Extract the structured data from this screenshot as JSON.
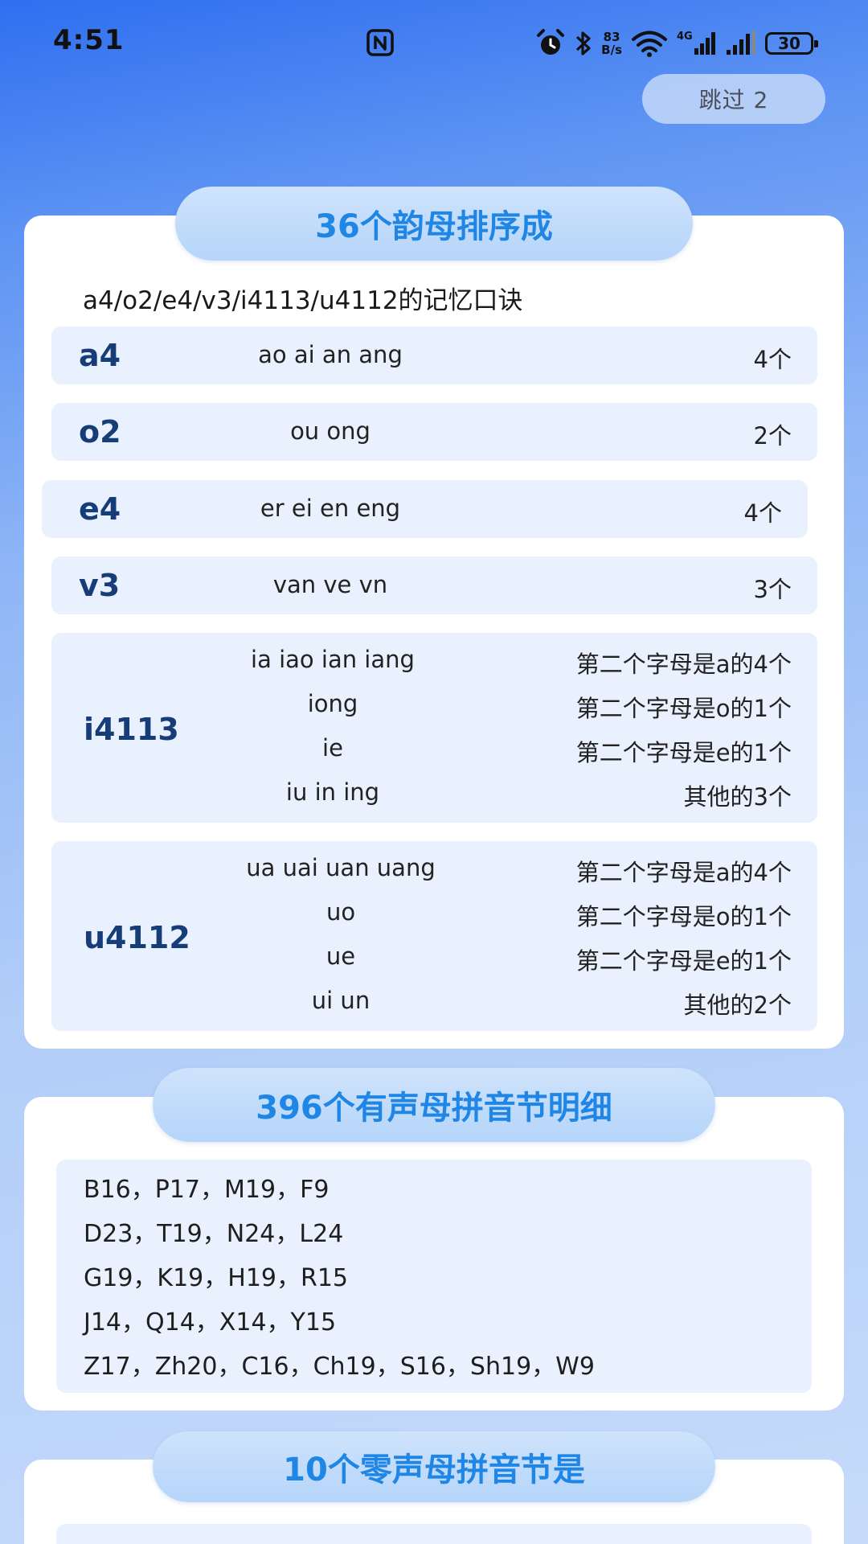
{
  "status_bar": {
    "time": "4:51",
    "net_speed_value": "83",
    "net_speed_unit": "B/s",
    "battery": "30"
  },
  "skip_label": "跳过 2",
  "section1": {
    "title": "36个韵母排序成",
    "subtitle": "a4/o2/e4/v3/i4113/u4112的记忆口诀",
    "rows": [
      {
        "label": "a4",
        "pinyin": "ao ai an ang",
        "count": "4个"
      },
      {
        "label": "o2",
        "pinyin": "ou ong",
        "count": "2个"
      },
      {
        "label": "e4",
        "pinyin": "er ei en eng",
        "count": "4个"
      },
      {
        "label": "v3",
        "pinyin": "van ve vn",
        "count": "3个"
      }
    ],
    "groups": [
      {
        "label": "i4113",
        "lines": [
          {
            "pinyin": "ia iao ian iang",
            "note": "第二个字母是a的4个"
          },
          {
            "pinyin": "iong",
            "note": "第二个字母是o的1个"
          },
          {
            "pinyin": "ie",
            "note": "第二个字母是e的1个"
          },
          {
            "pinyin": "iu in ing",
            "note": "其他的3个"
          }
        ]
      },
      {
        "label": "u4112",
        "lines": [
          {
            "pinyin": "ua uai uan uang",
            "note": "第二个字母是a的4个"
          },
          {
            "pinyin": "uo",
            "note": "第二个字母是o的1个"
          },
          {
            "pinyin": "ue",
            "note": "第二个字母是e的1个"
          },
          {
            "pinyin": "ui un",
            "note": "其他的2个"
          }
        ]
      }
    ]
  },
  "section2": {
    "title": "396个有声母拼音节明细",
    "lines": [
      "B16，P17，M19，F9",
      "D23，T19，N24，L24",
      "G19，K19，H19，R15",
      "J14，Q14，X14，Y15",
      "Z17，Zh20，C16，Ch19，S16，Sh19，W9"
    ]
  },
  "section3": {
    "title": "10个零声母拼音节是"
  }
}
